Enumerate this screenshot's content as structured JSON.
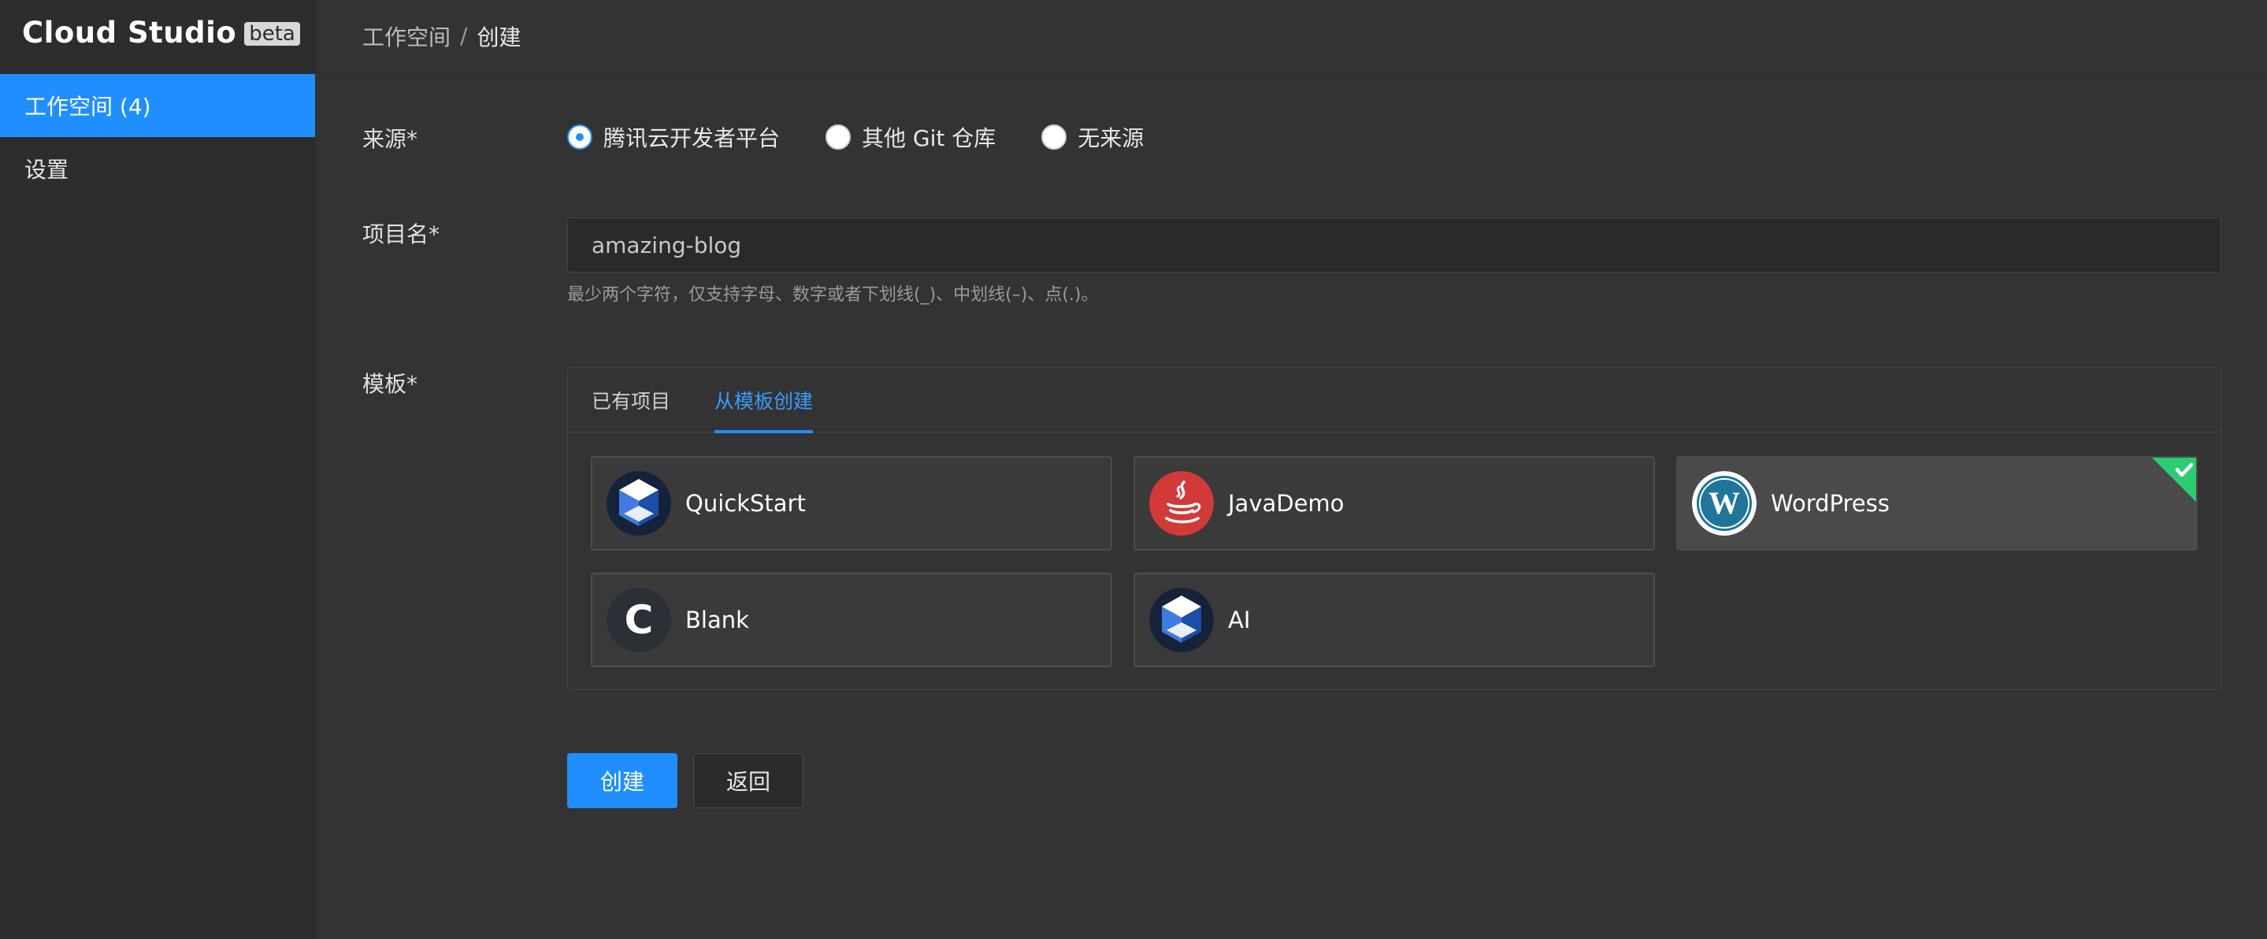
{
  "brand": {
    "name": "Cloud Studio",
    "badge": "beta"
  },
  "sidebar": {
    "items": [
      {
        "label": "工作空间 (4)",
        "active": true
      },
      {
        "label": "设置",
        "active": false
      }
    ]
  },
  "breadcrumb": {
    "parent": "工作空间",
    "separator": "/",
    "current": "创建"
  },
  "form": {
    "source": {
      "label": "来源*",
      "options": [
        {
          "label": "腾讯云开发者平台",
          "checked": true
        },
        {
          "label": "其他 Git 仓库",
          "checked": false
        },
        {
          "label": "无来源",
          "checked": false
        }
      ]
    },
    "project_name": {
      "label": "项目名*",
      "value": "amazing-blog",
      "hint": "最少两个字符，仅支持字母、数字或者下划线(_)、中划线(–)、点(.)。"
    },
    "template": {
      "label": "模板*",
      "tabs": [
        {
          "label": "已有项目",
          "active": false
        },
        {
          "label": "从模板创建",
          "active": true
        }
      ],
      "cards": [
        {
          "label": "QuickStart",
          "icon": "cube-icon",
          "selected": false
        },
        {
          "label": "JavaDemo",
          "icon": "java-icon",
          "selected": false
        },
        {
          "label": "WordPress",
          "icon": "wordpress-icon",
          "selected": true
        },
        {
          "label": "Blank",
          "icon": "letter-c-icon",
          "selected": false
        },
        {
          "label": "AI",
          "icon": "cube-icon",
          "selected": false
        }
      ]
    }
  },
  "actions": {
    "create_label": "创建",
    "back_label": "返回"
  },
  "colors": {
    "accent": "#1f8fff",
    "check_badge": "#2ecc71",
    "background": "#333333",
    "sidebar": "#2d2d2d"
  }
}
